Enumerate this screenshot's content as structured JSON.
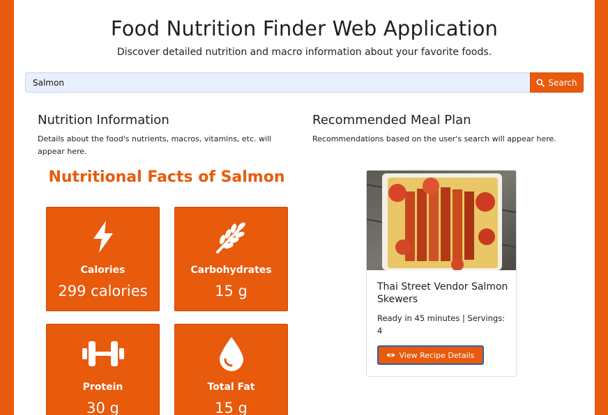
{
  "header": {
    "title": "Food Nutrition Finder Web Application",
    "subtitle": "Discover detailed nutrition and macro information about your favorite foods."
  },
  "search": {
    "value": "Salmon",
    "button_label": "Search",
    "button_icon": "search-icon"
  },
  "nutrition_section": {
    "title": "Nutrition Information",
    "description": "Details about the food's nutrients, macros, vitamins, etc. will appear here.",
    "facts_title": "Nutritional Facts of Salmon",
    "facts": [
      {
        "label": "Calories",
        "value": "299 calories",
        "icon": "bolt-icon"
      },
      {
        "label": "Carbohydrates",
        "value": "15 g",
        "icon": "wheat-icon"
      },
      {
        "label": "Protein",
        "value": "30 g",
        "icon": "dumbbell-icon"
      },
      {
        "label": "Total Fat",
        "value": "15 g",
        "icon": "droplet-icon"
      }
    ]
  },
  "meal_section": {
    "title": "Recommended Meal Plan",
    "description": "Recommendations based on the user's search will appear here.",
    "recipe": {
      "title": "Thai Street Vendor Salmon Skewers",
      "meta": "Ready in 45 minutes | Servings: 4",
      "button_label": "View Recipe Details",
      "button_icon": "eye-icon"
    }
  },
  "colors": {
    "accent": "#e85a0c",
    "button_outline": "#2f5fa8",
    "input_bg": "#e8f0fe"
  }
}
